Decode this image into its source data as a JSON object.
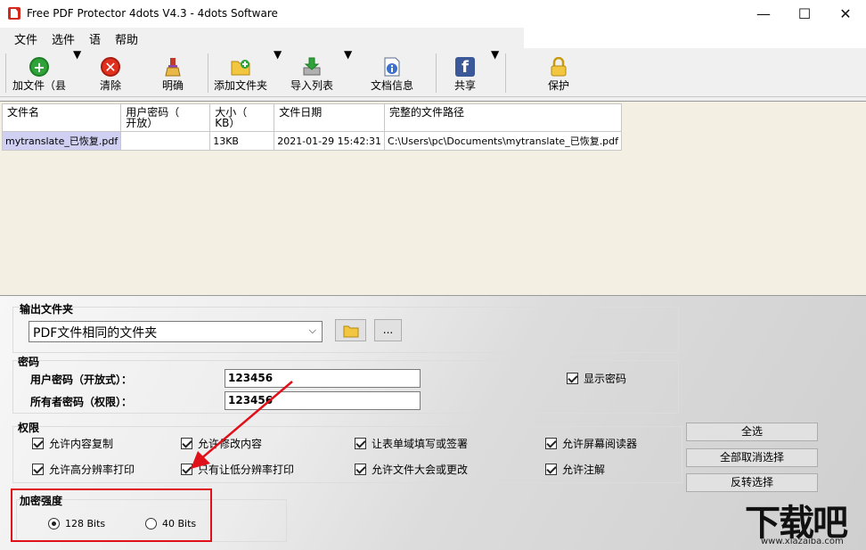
{
  "window": {
    "title": "Free PDF Protector 4dots V4.3 - 4dots Software",
    "minimize": "—",
    "maximize": "☐",
    "close": "✕"
  },
  "menu": [
    "文件",
    "选件",
    "语",
    "帮助"
  ],
  "toolbar": {
    "add_file": "加文件（县",
    "clear": "清除",
    "clarify": "明确",
    "add_folder": "添加文件夹",
    "import_list": "导入列表",
    "doc_info": "文档信息",
    "share": "共享",
    "protect": "保护"
  },
  "table": {
    "headers": [
      "文件名",
      "用户密码（\n开放）",
      "大小（\nKB）",
      "文件日期",
      "完整的文件路径"
    ],
    "rows": [
      [
        "mytranslate_已恢复.pdf",
        "",
        "13KB",
        "2021-01-29 15:42:31",
        "C:\\Users\\pc\\Documents\\mytranslate_已恢复.pdf"
      ]
    ]
  },
  "output": {
    "group_title": "输出文件夹",
    "folder_value": "PDF文件相同的文件夹",
    "browse_label": "..."
  },
  "password": {
    "group_title": "密码",
    "user_label": "用户密码（开放式）：",
    "user_value": "123456",
    "owner_label": "所有者密码（权限）：",
    "owner_value": "123456",
    "show_password": "显示密码"
  },
  "permissions": {
    "group_title": "权限",
    "items": [
      "允许内容复制",
      "允许修改内容",
      "让表单域填写或签署",
      "允许屏幕阅读器",
      "允许高分辨率打印",
      "只有让低分辨率打印",
      "允许文件大会或更改",
      "允许注解"
    ],
    "select_all": "全选",
    "deselect_all": "全部取消选择",
    "invert": "反转选择"
  },
  "encryption": {
    "group_title": "加密强度",
    "opt_128": "128 Bits",
    "opt_40": "40 Bits",
    "selected": "128 Bits"
  },
  "watermark": {
    "logo": "下载吧",
    "url": "www.xiazaiba.com"
  },
  "colors": {
    "highlight": "#e0101a",
    "selected_cell": "#cfd0f2",
    "grid_bg": "#f3f0e3"
  }
}
